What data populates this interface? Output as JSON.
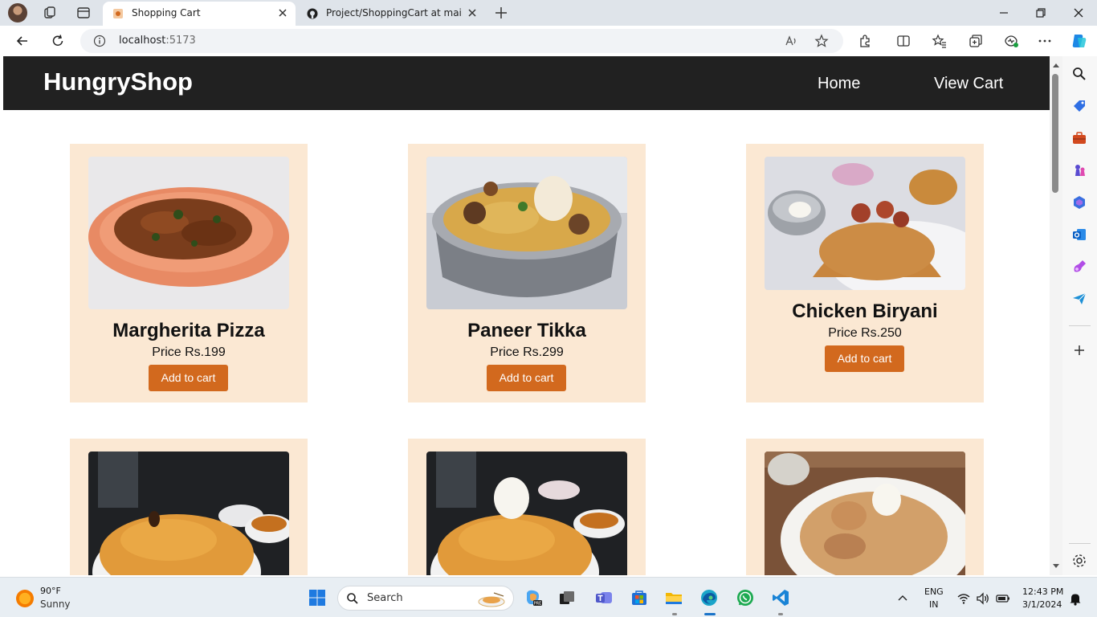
{
  "browser": {
    "tabs": [
      {
        "title": "Shopping Cart",
        "active": true
      },
      {
        "title": "Project/ShoppingCart at main · S",
        "active": false
      }
    ],
    "url": {
      "host": "localhost",
      "port": ":5173"
    }
  },
  "site": {
    "brand": "HungryShop",
    "nav": {
      "home": "Home",
      "cart": "View Cart"
    }
  },
  "products": [
    {
      "name": "Margherita Pizza",
      "price": "Price Rs.199",
      "button": "Add to cart"
    },
    {
      "name": "Paneer Tikka",
      "price": "Price Rs.299",
      "button": "Add to cart"
    },
    {
      "name": "Chicken Biryani",
      "price": "Price Rs.250",
      "button": "Add to cart"
    }
  ],
  "taskbar": {
    "weather": {
      "temp": "90°F",
      "desc": "Sunny"
    },
    "search_placeholder": "Search",
    "lang_line1": "ENG",
    "lang_line2": "IN",
    "time": "12:43 PM",
    "date": "3/1/2024"
  },
  "colors": {
    "header_bg": "#212121",
    "card_bg": "#fbe8d3",
    "button_bg": "#d2691e"
  }
}
